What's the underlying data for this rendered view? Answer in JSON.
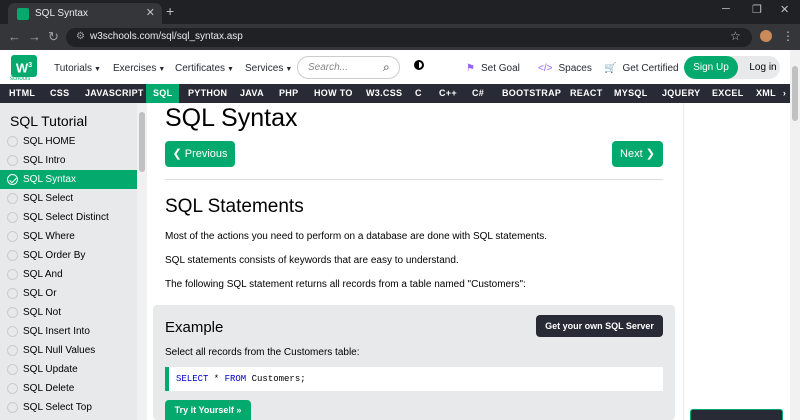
{
  "browser": {
    "tab_title": "SQL Syntax",
    "url": "w3schools.com/sql/sql_syntax.asp"
  },
  "header": {
    "logo_text": "W",
    "logo_sup": "3",
    "logo_sub": "schools",
    "menus": [
      "Tutorials",
      "Exercises",
      "Certificates",
      "Services"
    ],
    "search_placeholder": "Search...",
    "links": [
      "Set Goal",
      "Spaces",
      "Get Certified"
    ],
    "signup": "Sign Up",
    "login": "Log in"
  },
  "topnav": {
    "items": [
      "HTML",
      "CSS",
      "JAVASCRIPT",
      "SQL",
      "PYTHON",
      "JAVA",
      "PHP",
      "HOW TO",
      "W3.CSS",
      "C",
      "C++",
      "C#",
      "BOOTSTRAP",
      "REACT",
      "MYSQL",
      "JQUERY",
      "EXCEL",
      "XML"
    ],
    "active": "SQL"
  },
  "sidebar": {
    "title": "SQL Tutorial",
    "items": [
      "SQL HOME",
      "SQL Intro",
      "SQL Syntax",
      "SQL Select",
      "SQL Select Distinct",
      "SQL Where",
      "SQL Order By",
      "SQL And",
      "SQL Or",
      "SQL Not",
      "SQL Insert Into",
      "SQL Null Values",
      "SQL Update",
      "SQL Delete",
      "SQL Select Top"
    ],
    "active": "SQL Syntax"
  },
  "main": {
    "title": "SQL Syntax",
    "prev": "❮ Previous",
    "next": "Next ❯",
    "section_title": "SQL Statements",
    "paragraphs": [
      "Most of the actions you need to perform on a database are done with SQL statements.",
      "SQL statements consists of keywords that are easy to understand.",
      "The following SQL statement returns all records from a table named \"Customers\":"
    ],
    "example": {
      "heading": "Example",
      "server_button": "Get your own SQL Server",
      "description": "Select all records from the Customers table:",
      "code_kw1": "SELECT",
      "code_mid": " * ",
      "code_kw2": "FROM",
      "code_end": " Customers;",
      "try_button": "Try it Yourself »"
    }
  },
  "colors": {
    "accent": "#04aa6d",
    "dark": "#282a35",
    "sidebar_bg": "#e7e9eb"
  }
}
